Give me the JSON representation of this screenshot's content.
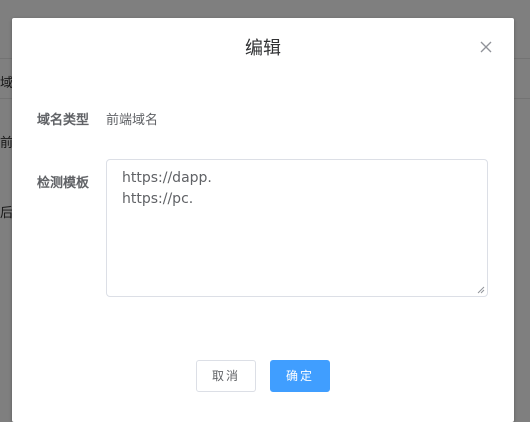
{
  "background": {
    "row_1_text": "域",
    "row_2_text": "前",
    "row_3_text": "后"
  },
  "dialog": {
    "title": "编辑",
    "close_icon": "close-icon",
    "fields": {
      "domain_type_label": "域名类型",
      "domain_type_value": "前端域名",
      "template_label": "检测模板",
      "template_lines": [
        "https://dapp.",
        "https://pc."
      ]
    },
    "buttons": {
      "cancel": "取消",
      "confirm": "确定"
    }
  },
  "colors": {
    "primary": "#409eff",
    "text": "#606266",
    "title": "#303133",
    "border": "#dcdfe6"
  }
}
